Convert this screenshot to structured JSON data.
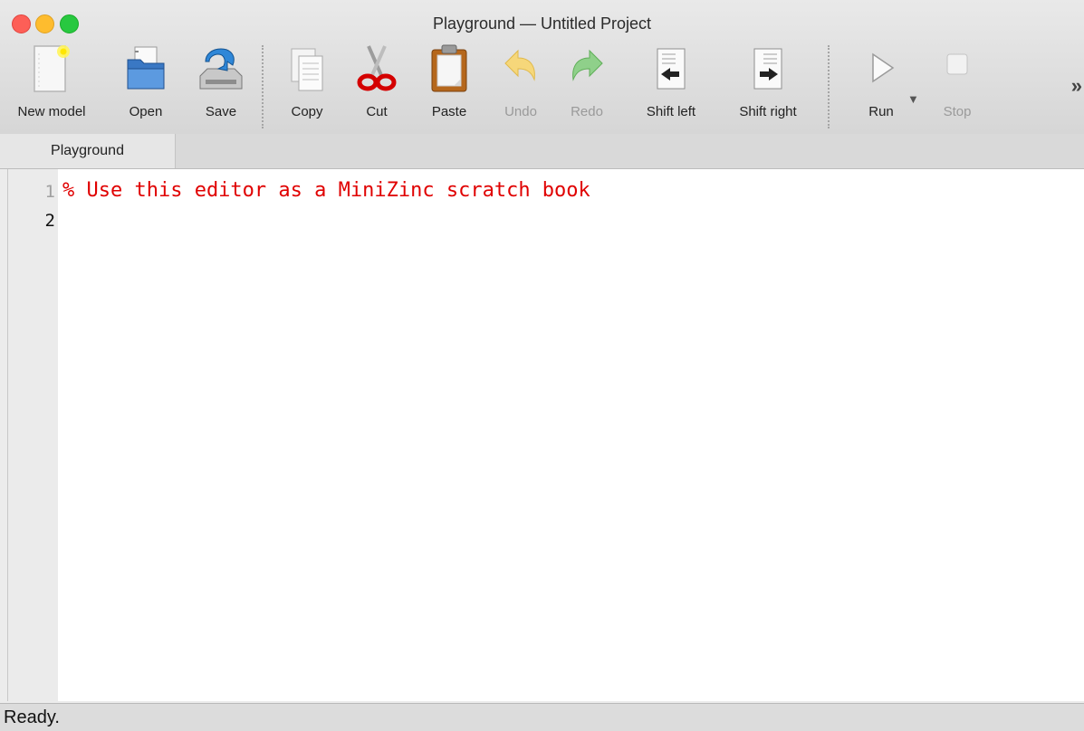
{
  "window": {
    "title": "Playground — Untitled Project"
  },
  "toolbar": {
    "items": [
      {
        "label": "New model",
        "icon": "new-model-icon",
        "enabled": true
      },
      {
        "label": "Open",
        "icon": "open-folder-icon",
        "enabled": true
      },
      {
        "label": "Save",
        "icon": "save-icon",
        "enabled": true
      },
      {
        "label": "Copy",
        "icon": "copy-icon",
        "enabled": true
      },
      {
        "label": "Cut",
        "icon": "scissors-icon",
        "enabled": true
      },
      {
        "label": "Paste",
        "icon": "clipboard-icon",
        "enabled": true
      },
      {
        "label": "Undo",
        "icon": "undo-arrow-icon",
        "enabled": false
      },
      {
        "label": "Redo",
        "icon": "redo-arrow-icon",
        "enabled": false
      },
      {
        "label": "Shift left",
        "icon": "shift-left-icon",
        "enabled": true
      },
      {
        "label": "Shift right",
        "icon": "shift-right-icon",
        "enabled": true
      },
      {
        "label": "Run",
        "icon": "play-icon",
        "enabled": true
      },
      {
        "label": "Stop",
        "icon": "stop-icon",
        "enabled": false
      }
    ],
    "overflow_glyph": "»"
  },
  "tabs": [
    {
      "label": "Playground",
      "active": true
    }
  ],
  "editor": {
    "line_numbers": [
      "1",
      "2"
    ],
    "lines": [
      "% Use this editor as a MiniZinc scratch book",
      ""
    ],
    "comment_color": "#e00000"
  },
  "status": {
    "text": "Ready."
  }
}
